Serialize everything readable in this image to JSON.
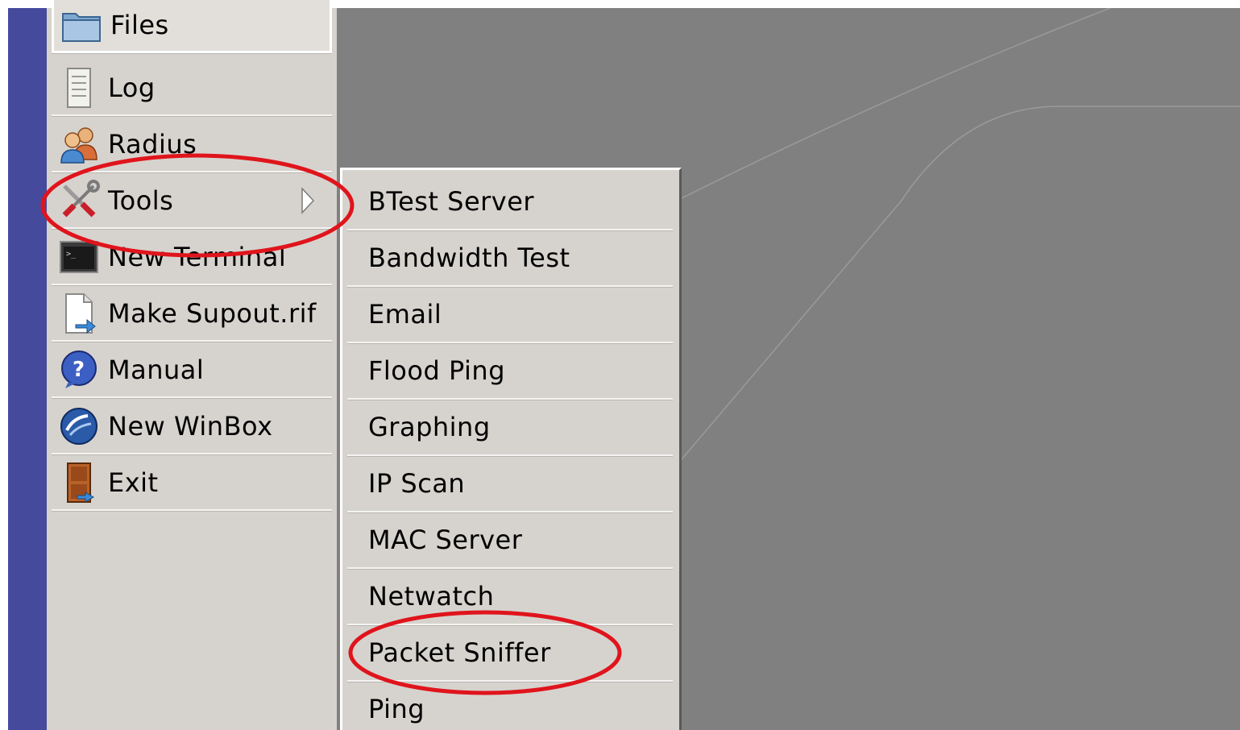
{
  "side_menu": {
    "items": [
      {
        "label": "Files",
        "icon": "folder-icon"
      },
      {
        "label": "Log",
        "icon": "log-icon"
      },
      {
        "label": "Radius",
        "icon": "users-icon"
      },
      {
        "label": "Tools",
        "icon": "tools-icon",
        "has_submenu": true
      },
      {
        "label": "New Terminal",
        "icon": "terminal-icon"
      },
      {
        "label": "Make Supout.rif",
        "icon": "document-export-icon"
      },
      {
        "label": "Manual",
        "icon": "help-icon"
      },
      {
        "label": "New WinBox",
        "icon": "winbox-icon"
      },
      {
        "label": "Exit",
        "icon": "exit-door-icon"
      }
    ]
  },
  "tools_submenu": {
    "items": [
      {
        "label": "BTest Server"
      },
      {
        "label": "Bandwidth Test"
      },
      {
        "label": "Email"
      },
      {
        "label": "Flood Ping"
      },
      {
        "label": "Graphing"
      },
      {
        "label": "IP Scan"
      },
      {
        "label": "MAC Server"
      },
      {
        "label": "Netwatch"
      },
      {
        "label": "Packet Sniffer"
      },
      {
        "label": "Ping"
      }
    ]
  },
  "colors": {
    "left_strip": "#464a9c",
    "menu_background": "#d6d3ce",
    "workspace": "#808080",
    "annotation": "#e0141c"
  }
}
